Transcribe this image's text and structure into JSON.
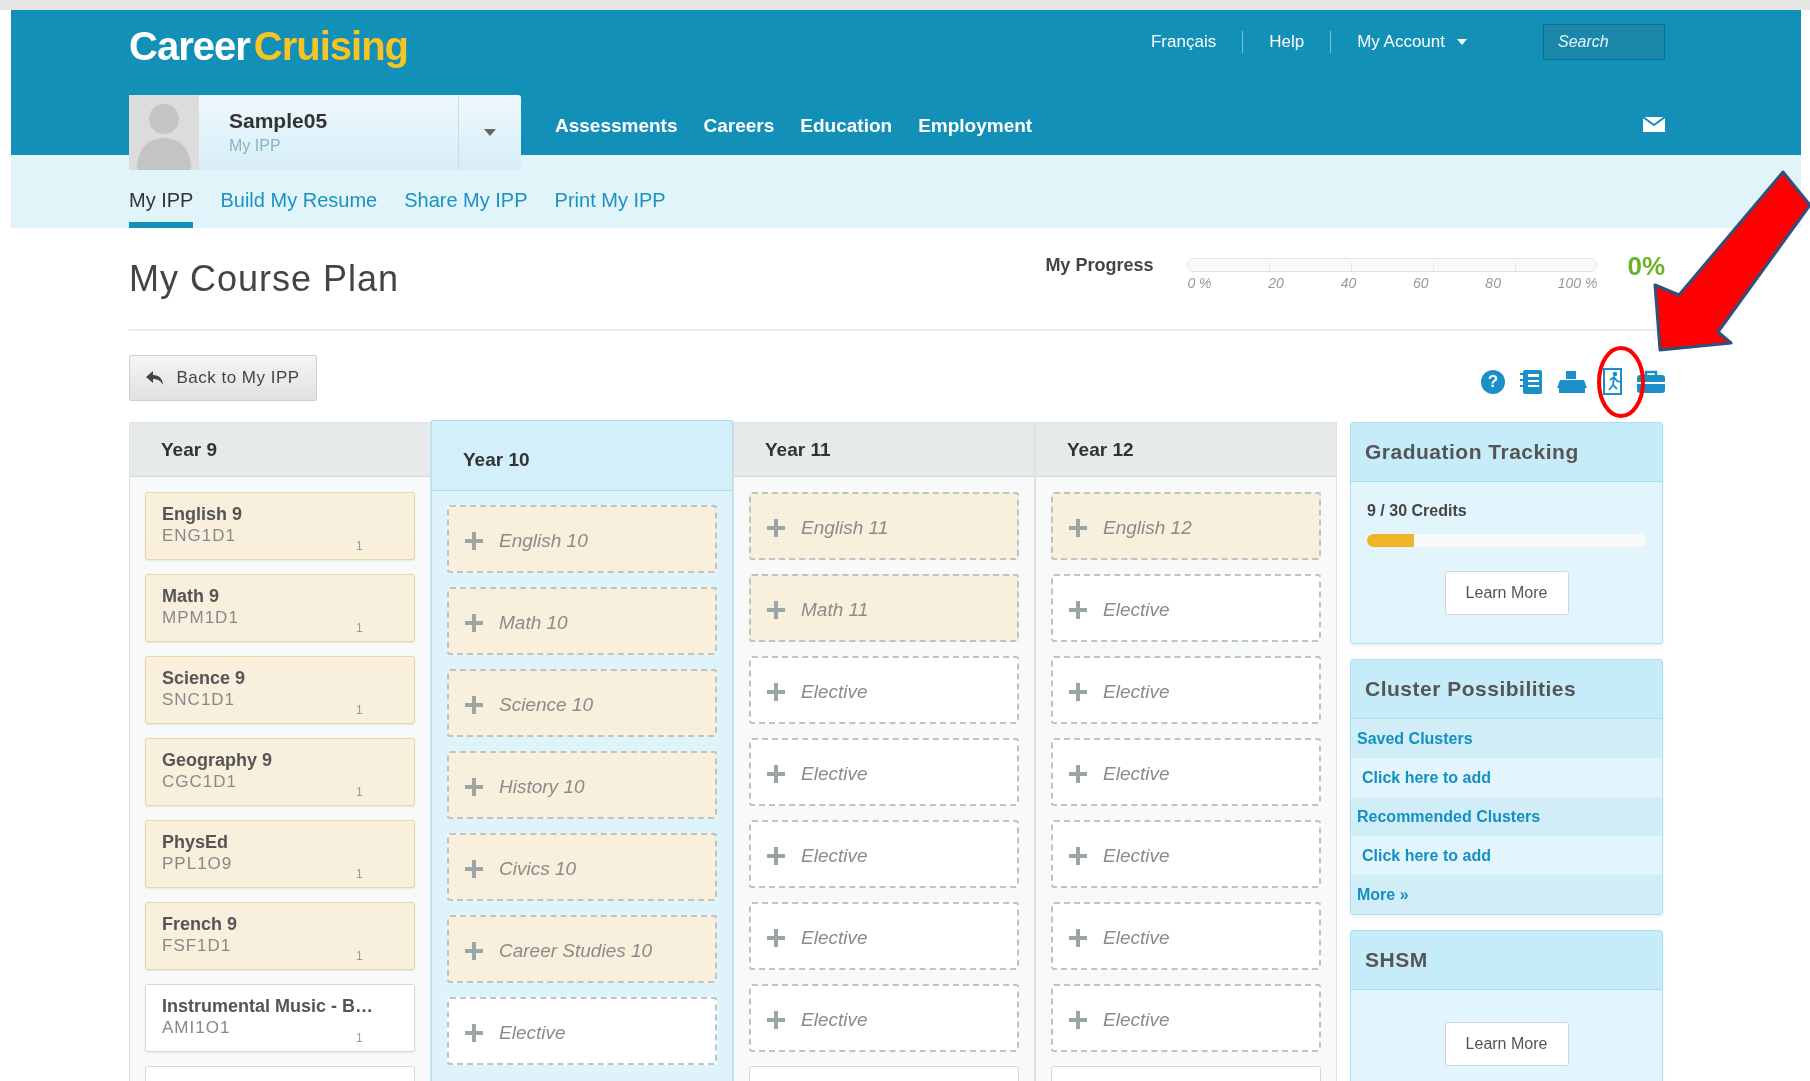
{
  "logo": {
    "first": "Career",
    "second": "Cruising"
  },
  "top_links": [
    "Français",
    "Help"
  ],
  "account_menu": {
    "label": "My Account"
  },
  "search": {
    "placeholder": "Search"
  },
  "profile": {
    "name": "Sample05",
    "subtitle": "My IPP"
  },
  "main_nav": [
    "Assessments",
    "Careers",
    "Education",
    "Employment"
  ],
  "sub_tabs": [
    {
      "label": "My IPP",
      "selected": true
    },
    {
      "label": "Build My Resume",
      "selected": false
    },
    {
      "label": "Share My IPP",
      "selected": false
    },
    {
      "label": "Print My IPP",
      "selected": false
    }
  ],
  "page_title": "My Course Plan",
  "progress": {
    "label": "My Progress",
    "level": 0,
    "ticks": [
      "0 %",
      "20",
      "40",
      "60",
      "80",
      "100 %"
    ],
    "percent": "0%"
  },
  "back_button": "Back to My IPP",
  "toolbar": [
    {
      "kind": "help",
      "glyph": "?"
    },
    {
      "kind": "notebook"
    },
    {
      "kind": "printer"
    },
    {
      "kind": "exit"
    },
    {
      "kind": "briefcase"
    }
  ],
  "years": [
    {
      "title": "Year 9",
      "selected": false,
      "courses": [
        {
          "kind": "course",
          "name": "English 9",
          "code": "ENG1D1",
          "credit": "1",
          "required": true
        },
        {
          "kind": "course",
          "name": "Math 9",
          "code": "MPM1D1",
          "credit": "1",
          "required": true
        },
        {
          "kind": "course",
          "name": "Science 9",
          "code": "SNC1D1",
          "credit": "1",
          "required": true
        },
        {
          "kind": "course",
          "name": "Geography 9",
          "code": "CGC1D1",
          "credit": "1",
          "required": true
        },
        {
          "kind": "course",
          "name": "PhysEd",
          "code": "PPL1O9",
          "credit": "1",
          "required": true
        },
        {
          "kind": "course",
          "name": "French 9",
          "code": "FSF1D1",
          "credit": "1",
          "required": true
        },
        {
          "kind": "course",
          "name": "Instrumental Music - B…",
          "code": "AMI1O1",
          "credit": "1",
          "required": false
        },
        {
          "kind": "cutoff",
          "required": false
        }
      ]
    },
    {
      "title": "Year 10",
      "selected": true,
      "courses": [
        {
          "kind": "slot",
          "name": "English 10",
          "required": true
        },
        {
          "kind": "slot",
          "name": "Math 10",
          "required": true
        },
        {
          "kind": "slot",
          "name": "Science 10",
          "required": true
        },
        {
          "kind": "slot",
          "name": "History 10",
          "required": true
        },
        {
          "kind": "slot",
          "name": "Civics 10",
          "required": true
        },
        {
          "kind": "slot",
          "name": "Career Studies 10",
          "required": true
        },
        {
          "kind": "slot",
          "name": "Elective",
          "required": false
        }
      ]
    },
    {
      "title": "Year 11",
      "selected": false,
      "courses": [
        {
          "kind": "slot",
          "name": "English 11",
          "required": true
        },
        {
          "kind": "slot",
          "name": "Math 11",
          "required": true
        },
        {
          "kind": "slot",
          "name": "Elective",
          "required": false
        },
        {
          "kind": "slot",
          "name": "Elective",
          "required": false
        },
        {
          "kind": "slot",
          "name": "Elective",
          "required": false
        },
        {
          "kind": "slot",
          "name": "Elective",
          "required": false
        },
        {
          "kind": "slot",
          "name": "Elective",
          "required": false
        },
        {
          "kind": "cutoff",
          "required": false
        }
      ]
    },
    {
      "title": "Year 12",
      "selected": false,
      "courses": [
        {
          "kind": "slot",
          "name": "English 12",
          "required": true
        },
        {
          "kind": "slot",
          "name": "Elective",
          "required": false
        },
        {
          "kind": "slot",
          "name": "Elective",
          "required": false
        },
        {
          "kind": "slot",
          "name": "Elective",
          "required": false
        },
        {
          "kind": "slot",
          "name": "Elective",
          "required": false
        },
        {
          "kind": "slot",
          "name": "Elective",
          "required": false
        },
        {
          "kind": "slot",
          "name": "Elective",
          "required": false
        },
        {
          "kind": "cutoff",
          "required": false
        }
      ]
    }
  ],
  "graduation_tracking": {
    "title": "Graduation Tracking",
    "credits": "9 / 30 Credits",
    "level": 0.17,
    "button": "Learn More"
  },
  "cluster_possibilities": {
    "title": "Cluster Possibilities",
    "rows": [
      {
        "kind": "heading",
        "label": "Saved Clusters"
      },
      {
        "kind": "link",
        "label": "Click here to add"
      },
      {
        "kind": "heading",
        "label": "Recommended Clusters"
      },
      {
        "kind": "link",
        "label": "Click here to add"
      },
      {
        "kind": "heading",
        "label": "More »"
      }
    ]
  },
  "shsm": {
    "title": "SHSM",
    "button": "Learn More"
  }
}
